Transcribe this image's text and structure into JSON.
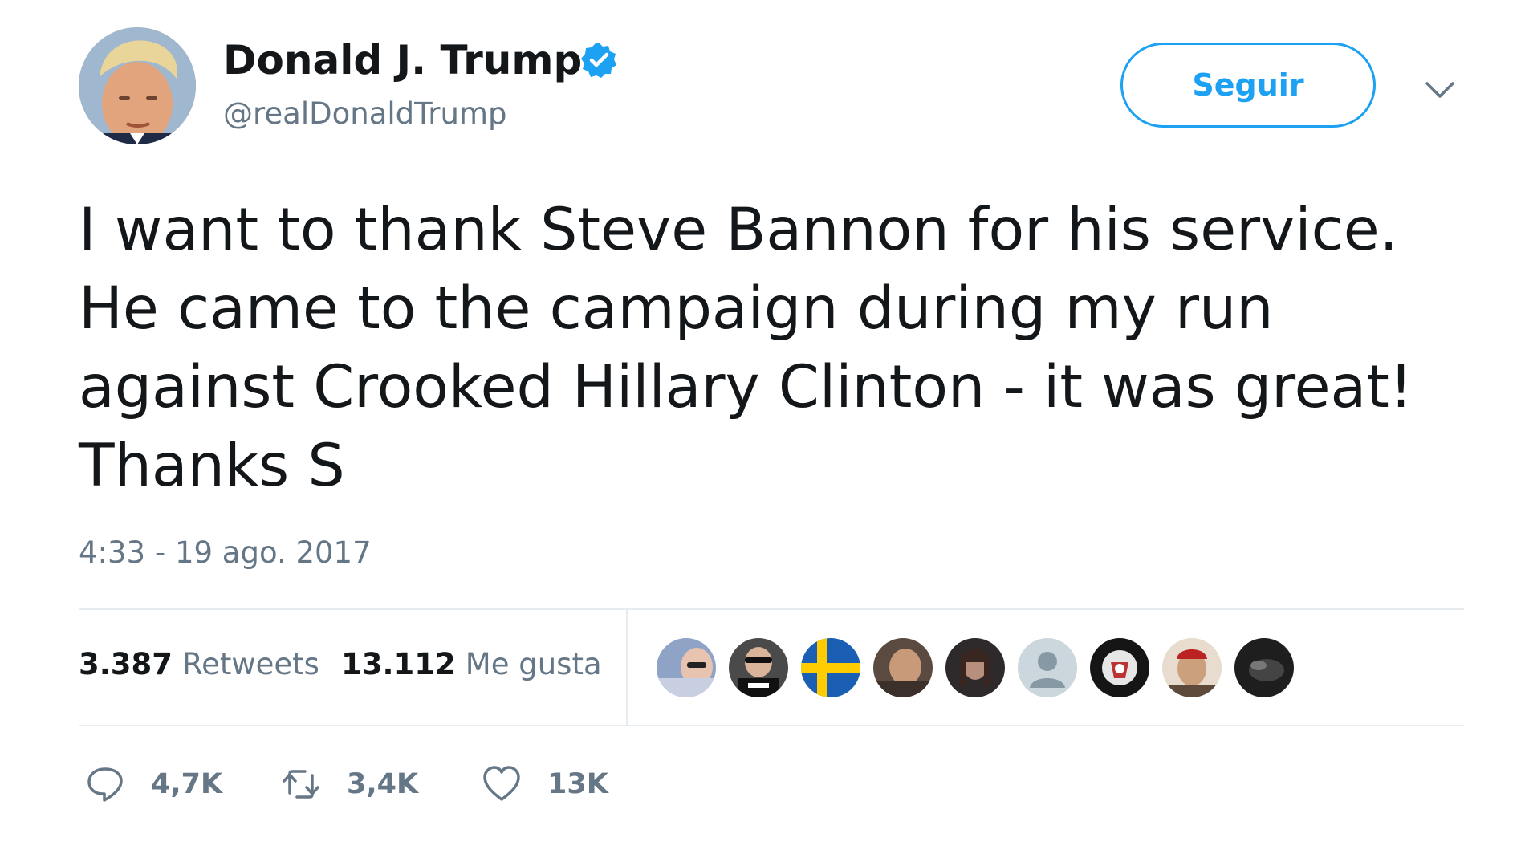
{
  "header": {
    "display_name": "Donald J. Trump",
    "handle": "@realDonaldTrump",
    "verified": true,
    "follow_label": "Seguir"
  },
  "tweet": {
    "text": "I want to thank Steve Bannon for his service. He came to the campaign during my run against Crooked Hillary Clinton - it was great! Thanks S",
    "timestamp": "4:33 - 19 ago. 2017"
  },
  "stats": {
    "retweets_count": "3.387",
    "retweets_label": "Retweets",
    "likes_count": "13.112",
    "likes_label": "Me gusta"
  },
  "likers": [
    {
      "icon": "avatar-photo"
    },
    {
      "icon": "avatar-photo"
    },
    {
      "icon": "swedish-flag"
    },
    {
      "icon": "avatar-photo"
    },
    {
      "icon": "avatar-photo"
    },
    {
      "icon": "default-avatar"
    },
    {
      "icon": "avatar-photo"
    },
    {
      "icon": "avatar-photo"
    },
    {
      "icon": "avatar-photo"
    }
  ],
  "actions": {
    "reply_count": "4,7K",
    "retweet_count": "3,4K",
    "like_count": "13K"
  },
  "colors": {
    "accent": "#1da1f2",
    "text": "#14171a",
    "secondary_text": "#657786",
    "divider": "#e6ecf0"
  }
}
